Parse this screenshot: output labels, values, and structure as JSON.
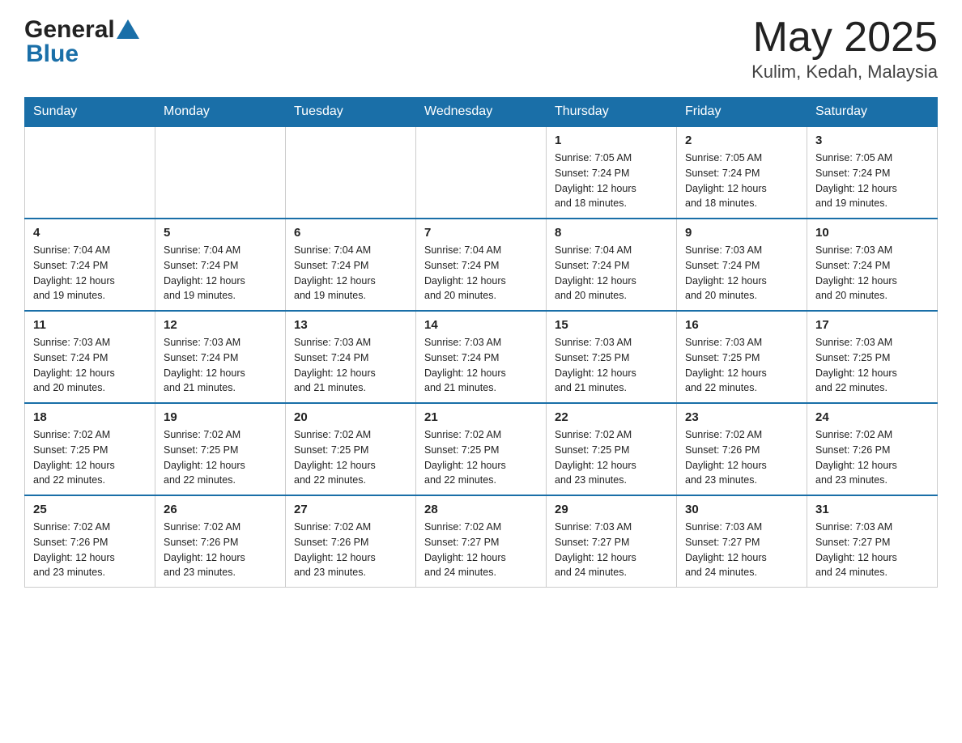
{
  "header": {
    "month_title": "May 2025",
    "location": "Kulim, Kedah, Malaysia",
    "logo_general": "General",
    "logo_blue": "Blue"
  },
  "weekdays": [
    "Sunday",
    "Monday",
    "Tuesday",
    "Wednesday",
    "Thursday",
    "Friday",
    "Saturday"
  ],
  "weeks": [
    [
      {
        "day": "",
        "info": ""
      },
      {
        "day": "",
        "info": ""
      },
      {
        "day": "",
        "info": ""
      },
      {
        "day": "",
        "info": ""
      },
      {
        "day": "1",
        "info": "Sunrise: 7:05 AM\nSunset: 7:24 PM\nDaylight: 12 hours\nand 18 minutes."
      },
      {
        "day": "2",
        "info": "Sunrise: 7:05 AM\nSunset: 7:24 PM\nDaylight: 12 hours\nand 18 minutes."
      },
      {
        "day": "3",
        "info": "Sunrise: 7:05 AM\nSunset: 7:24 PM\nDaylight: 12 hours\nand 19 minutes."
      }
    ],
    [
      {
        "day": "4",
        "info": "Sunrise: 7:04 AM\nSunset: 7:24 PM\nDaylight: 12 hours\nand 19 minutes."
      },
      {
        "day": "5",
        "info": "Sunrise: 7:04 AM\nSunset: 7:24 PM\nDaylight: 12 hours\nand 19 minutes."
      },
      {
        "day": "6",
        "info": "Sunrise: 7:04 AM\nSunset: 7:24 PM\nDaylight: 12 hours\nand 19 minutes."
      },
      {
        "day": "7",
        "info": "Sunrise: 7:04 AM\nSunset: 7:24 PM\nDaylight: 12 hours\nand 20 minutes."
      },
      {
        "day": "8",
        "info": "Sunrise: 7:04 AM\nSunset: 7:24 PM\nDaylight: 12 hours\nand 20 minutes."
      },
      {
        "day": "9",
        "info": "Sunrise: 7:03 AM\nSunset: 7:24 PM\nDaylight: 12 hours\nand 20 minutes."
      },
      {
        "day": "10",
        "info": "Sunrise: 7:03 AM\nSunset: 7:24 PM\nDaylight: 12 hours\nand 20 minutes."
      }
    ],
    [
      {
        "day": "11",
        "info": "Sunrise: 7:03 AM\nSunset: 7:24 PM\nDaylight: 12 hours\nand 20 minutes."
      },
      {
        "day": "12",
        "info": "Sunrise: 7:03 AM\nSunset: 7:24 PM\nDaylight: 12 hours\nand 21 minutes."
      },
      {
        "day": "13",
        "info": "Sunrise: 7:03 AM\nSunset: 7:24 PM\nDaylight: 12 hours\nand 21 minutes."
      },
      {
        "day": "14",
        "info": "Sunrise: 7:03 AM\nSunset: 7:24 PM\nDaylight: 12 hours\nand 21 minutes."
      },
      {
        "day": "15",
        "info": "Sunrise: 7:03 AM\nSunset: 7:25 PM\nDaylight: 12 hours\nand 21 minutes."
      },
      {
        "day": "16",
        "info": "Sunrise: 7:03 AM\nSunset: 7:25 PM\nDaylight: 12 hours\nand 22 minutes."
      },
      {
        "day": "17",
        "info": "Sunrise: 7:03 AM\nSunset: 7:25 PM\nDaylight: 12 hours\nand 22 minutes."
      }
    ],
    [
      {
        "day": "18",
        "info": "Sunrise: 7:02 AM\nSunset: 7:25 PM\nDaylight: 12 hours\nand 22 minutes."
      },
      {
        "day": "19",
        "info": "Sunrise: 7:02 AM\nSunset: 7:25 PM\nDaylight: 12 hours\nand 22 minutes."
      },
      {
        "day": "20",
        "info": "Sunrise: 7:02 AM\nSunset: 7:25 PM\nDaylight: 12 hours\nand 22 minutes."
      },
      {
        "day": "21",
        "info": "Sunrise: 7:02 AM\nSunset: 7:25 PM\nDaylight: 12 hours\nand 22 minutes."
      },
      {
        "day": "22",
        "info": "Sunrise: 7:02 AM\nSunset: 7:25 PM\nDaylight: 12 hours\nand 23 minutes."
      },
      {
        "day": "23",
        "info": "Sunrise: 7:02 AM\nSunset: 7:26 PM\nDaylight: 12 hours\nand 23 minutes."
      },
      {
        "day": "24",
        "info": "Sunrise: 7:02 AM\nSunset: 7:26 PM\nDaylight: 12 hours\nand 23 minutes."
      }
    ],
    [
      {
        "day": "25",
        "info": "Sunrise: 7:02 AM\nSunset: 7:26 PM\nDaylight: 12 hours\nand 23 minutes."
      },
      {
        "day": "26",
        "info": "Sunrise: 7:02 AM\nSunset: 7:26 PM\nDaylight: 12 hours\nand 23 minutes."
      },
      {
        "day": "27",
        "info": "Sunrise: 7:02 AM\nSunset: 7:26 PM\nDaylight: 12 hours\nand 23 minutes."
      },
      {
        "day": "28",
        "info": "Sunrise: 7:02 AM\nSunset: 7:27 PM\nDaylight: 12 hours\nand 24 minutes."
      },
      {
        "day": "29",
        "info": "Sunrise: 7:03 AM\nSunset: 7:27 PM\nDaylight: 12 hours\nand 24 minutes."
      },
      {
        "day": "30",
        "info": "Sunrise: 7:03 AM\nSunset: 7:27 PM\nDaylight: 12 hours\nand 24 minutes."
      },
      {
        "day": "31",
        "info": "Sunrise: 7:03 AM\nSunset: 7:27 PM\nDaylight: 12 hours\nand 24 minutes."
      }
    ]
  ]
}
